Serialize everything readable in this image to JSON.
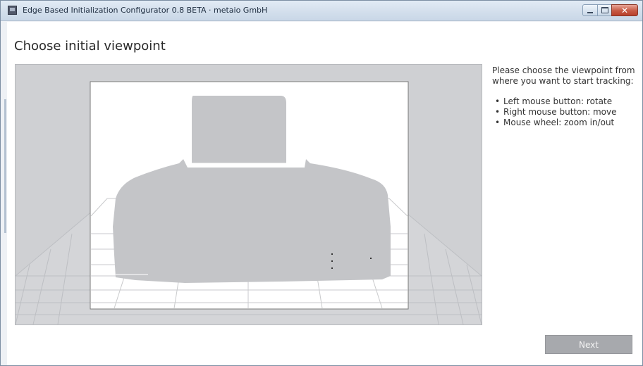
{
  "window": {
    "title": "Edge Based Initialization Configurator 0.8 BETA · metaio GmbH",
    "close_glyph": "✕",
    "icons": [
      "app-icon",
      "minimize-icon",
      "maximize-icon",
      "close-icon"
    ]
  },
  "page": {
    "heading": "Choose initial viewpoint"
  },
  "instructions": {
    "intro": "Please choose the viewpoint from where you want to start tracking:",
    "bullets": [
      "Left mouse button: rotate",
      "Right mouse button: move",
      "Mouse wheel: zoom in/out"
    ]
  },
  "footer": {
    "next_label": "Next"
  },
  "colors": {
    "viewport_bg": "#cfd0d3",
    "model_fill": "#c4c5c8",
    "grid_line": "#b9bbbf",
    "button_disabled": "#a7a9ad"
  }
}
